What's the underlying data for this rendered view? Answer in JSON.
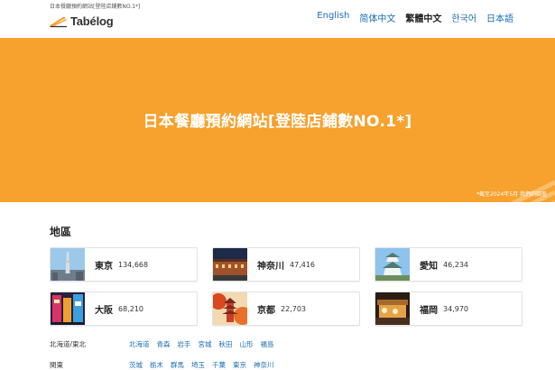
{
  "header": {
    "top_note": "日本餐廳預約網站[登陸店鋪數NO.1*]",
    "logo_text": "Tabélog",
    "languages": [
      {
        "label": "English",
        "active": false
      },
      {
        "label": "简体中文",
        "active": false
      },
      {
        "label": "繁體中文",
        "active": true
      },
      {
        "label": "한국어",
        "active": false
      },
      {
        "label": "日本語",
        "active": false
      }
    ]
  },
  "hero": {
    "title": "日本餐廳預約網站[登陸店鋪數NO.1*]",
    "footnote": "*截至2024年5月 我們的調查",
    "background_color": "#f7a12e"
  },
  "areas": {
    "title": "地區",
    "cities": [
      {
        "name": "東京",
        "count": "134,668",
        "image": "tokyo-skytree-photo"
      },
      {
        "name": "神奈川",
        "count": "47,416",
        "image": "kanagawa-brick-warehouse-photo"
      },
      {
        "name": "愛知",
        "count": "46,234",
        "image": "nagoya-castle-photo"
      },
      {
        "name": "大阪",
        "count": "68,210",
        "image": "osaka-dotonbori-photo"
      },
      {
        "name": "京都",
        "count": "22,703",
        "image": "kyoto-pagoda-autumn-photo"
      },
      {
        "name": "福岡",
        "count": "34,970",
        "image": "fukuoka-yatai-photo"
      }
    ]
  },
  "regions": [
    {
      "name": "北海道/東北",
      "prefectures": [
        "北海道",
        "青森",
        "岩手",
        "宮城",
        "秋田",
        "山形",
        "福島"
      ]
    },
    {
      "name": "関東",
      "prefectures": [
        "茨城",
        "栃木",
        "群馬",
        "埼玉",
        "千葉",
        "東京",
        "神奈川"
      ]
    }
  ],
  "colors": {
    "link": "#1a6db5",
    "accent": "#f7a12e"
  }
}
